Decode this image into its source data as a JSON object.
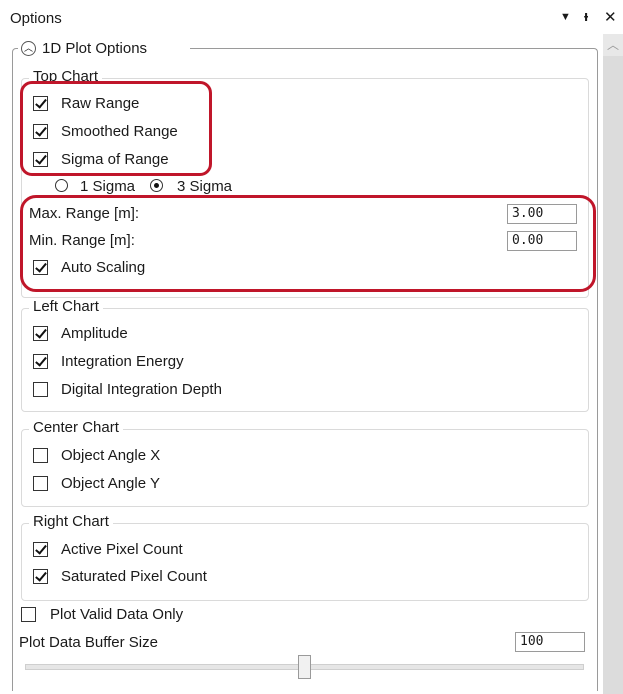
{
  "window": {
    "title": "Options",
    "icons": {
      "dropdown": "▼",
      "pin": "ᵻ",
      "close": "✕"
    }
  },
  "section": {
    "title": "1D Plot Options"
  },
  "top_chart": {
    "title": "Top Chart",
    "raw_range": {
      "label": "Raw Range",
      "checked": true
    },
    "smoothed_range": {
      "label": "Smoothed Range",
      "checked": true
    },
    "sigma_of_range": {
      "label": "Sigma of Range",
      "checked": true
    },
    "sigma_options": [
      {
        "label": "1 Sigma",
        "selected": false
      },
      {
        "label": "3 Sigma",
        "selected": true
      }
    ],
    "max_range": {
      "label": "Max. Range [m]:",
      "value": "3.00"
    },
    "min_range": {
      "label": "Min. Range [m]:",
      "value": "0.00"
    },
    "auto_scaling": {
      "label": "Auto Scaling",
      "checked": true
    }
  },
  "left_chart": {
    "title": "Left Chart",
    "amplitude": {
      "label": "Amplitude",
      "checked": true
    },
    "integration_energy": {
      "label": "Integration Energy",
      "checked": true
    },
    "digital_integration_depth": {
      "label": "Digital Integration Depth",
      "checked": false
    }
  },
  "center_chart": {
    "title": "Center Chart",
    "object_angle_x": {
      "label": "Object Angle X",
      "checked": false
    },
    "object_angle_y": {
      "label": "Object Angle Y",
      "checked": false
    }
  },
  "right_chart": {
    "title": "Right Chart",
    "active_pixel_count": {
      "label": "Active Pixel Count",
      "checked": true
    },
    "saturated_pixel_count": {
      "label": "Saturated Pixel Count",
      "checked": true
    }
  },
  "plot_valid_data_only": {
    "label": "Plot Valid Data Only",
    "checked": false
  },
  "buffer_size": {
    "label": "Plot Data Buffer Size",
    "value": "100",
    "slider_fraction": 0.49
  },
  "highlight_color": "#c0162a"
}
